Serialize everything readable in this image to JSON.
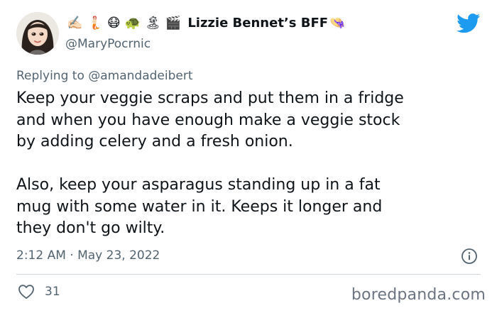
{
  "author": {
    "emojis": [
      "✍🏻",
      "🧜🏻",
      "😷",
      "🐢",
      "🏝",
      "🎬"
    ],
    "display_name": "Lizzie Bennet’s BFF",
    "hat_emoji": "👒",
    "handle": "@MaryPocrnic"
  },
  "reply": {
    "prefix": "Replying to ",
    "mention": "@amandadeibert"
  },
  "tweet": {
    "paragraphs": [
      "Keep your veggie scraps and put them in a fridge\nand when you have enough make a veggie stock\nby adding celery and a fresh onion.",
      "Also, keep your asparagus standing up in a fat\nmug with some water in it. Keeps it longer and\nthey don't go wilty."
    ],
    "timestamp": "2:12 AM · May 23, 2022"
  },
  "engagement": {
    "likes": "31"
  },
  "watermark": "boredpanda.com",
  "colors": {
    "twitter_blue": "#1d9bf0",
    "text_primary": "#0f1419",
    "text_secondary": "#536471",
    "divider": "#cfd9de"
  },
  "icons": [
    "avatar",
    "twitter-bird-icon",
    "info-icon",
    "heart-icon"
  ]
}
